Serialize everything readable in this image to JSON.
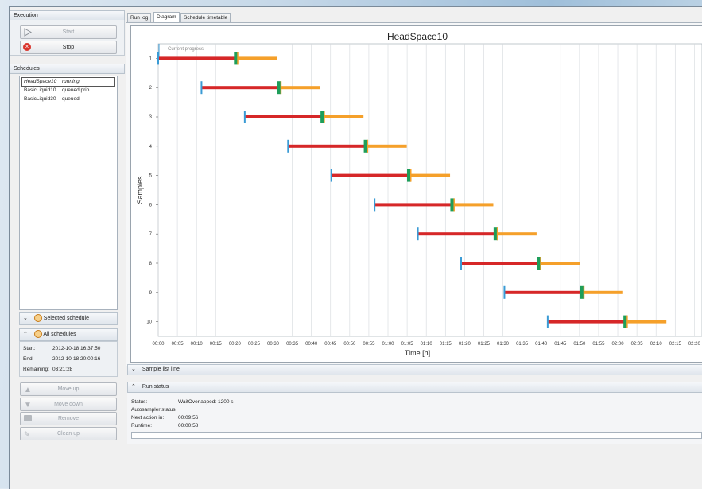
{
  "execution": {
    "title": "Execution",
    "start_label": "Start",
    "stop_label": "Stop"
  },
  "schedules": {
    "title": "Schedules",
    "items": [
      {
        "name": "HeadSpace10",
        "status": "running"
      },
      {
        "name": "BasicLiquid10",
        "status": "queued prio"
      },
      {
        "name": "BasicLiquid30",
        "status": "queued"
      }
    ],
    "selected_schedule_label": "Selected schedule",
    "all_schedules_label": "All schedules",
    "start_label": "Start:",
    "start_value": "2012-10-18 16:37:50",
    "end_label": "End:",
    "end_value": "2012-10-18 20:00:16",
    "remaining_label": "Remaining:",
    "remaining_value": "03:21:28"
  },
  "actions": {
    "move_up": "Move up",
    "move_down": "Move down",
    "remove": "Remove",
    "clean_up": "Clean up"
  },
  "tabs": [
    "Run log",
    "Diagram",
    "Schedule timetable"
  ],
  "active_tab": 1,
  "sample_list_line_label": "Sample list line",
  "run_status": {
    "title": "Run status",
    "status_label": "Status:",
    "status_value": "WaitOverlapped: 1200 s",
    "autosampler_label": "Autosampler status:",
    "autosampler_value": "",
    "next_action_label": "Next action in:",
    "next_action_value": "00:09:56",
    "runtime_label": "Runtime:",
    "runtime_value": "00:00:58"
  },
  "colors": {
    "prep_bar": "#d62728",
    "run_bar": "#f5a02a",
    "start_marker": "#3a9bd5",
    "inject_marker": "#1e9e5a",
    "stop_icon": "#d9342b"
  },
  "chart_data": {
    "type": "gantt",
    "title": "HeadSpace10",
    "xlabel": "Time [h]",
    "ylabel": "Samples",
    "annotation": "Current progress",
    "x_ticks": [
      "00:00",
      "00:05",
      "00:10",
      "00:15",
      "00:20",
      "00:25",
      "00:30",
      "00:35",
      "00:40",
      "00:45",
      "00:50",
      "00:55",
      "01:00",
      "01:05",
      "01:10",
      "01:15",
      "01:20",
      "01:25",
      "01:30",
      "01:35",
      "01:40",
      "01:45",
      "01:50",
      "01:55",
      "02:00",
      "02:05",
      "02:10",
      "02:15",
      "02:20"
    ],
    "xlim_minutes": [
      0,
      142
    ],
    "grid": true,
    "samples": [
      {
        "sample": 1,
        "start_min": 0,
        "inject_min": 20.3,
        "end_min": 31.0
      },
      {
        "sample": 2,
        "start_min": 11.3,
        "inject_min": 31.6,
        "end_min": 42.3
      },
      {
        "sample": 3,
        "start_min": 22.6,
        "inject_min": 42.9,
        "end_min": 53.6
      },
      {
        "sample": 4,
        "start_min": 33.9,
        "inject_min": 54.2,
        "end_min": 64.9
      },
      {
        "sample": 5,
        "start_min": 45.2,
        "inject_min": 65.5,
        "end_min": 76.2
      },
      {
        "sample": 6,
        "start_min": 56.5,
        "inject_min": 76.8,
        "end_min": 87.5
      },
      {
        "sample": 7,
        "start_min": 67.8,
        "inject_min": 88.1,
        "end_min": 98.8
      },
      {
        "sample": 8,
        "start_min": 79.1,
        "inject_min": 99.4,
        "end_min": 110.1
      },
      {
        "sample": 9,
        "start_min": 90.4,
        "inject_min": 110.7,
        "end_min": 121.4
      },
      {
        "sample": 10,
        "start_min": 101.7,
        "inject_min": 122.0,
        "end_min": 132.7
      }
    ]
  }
}
